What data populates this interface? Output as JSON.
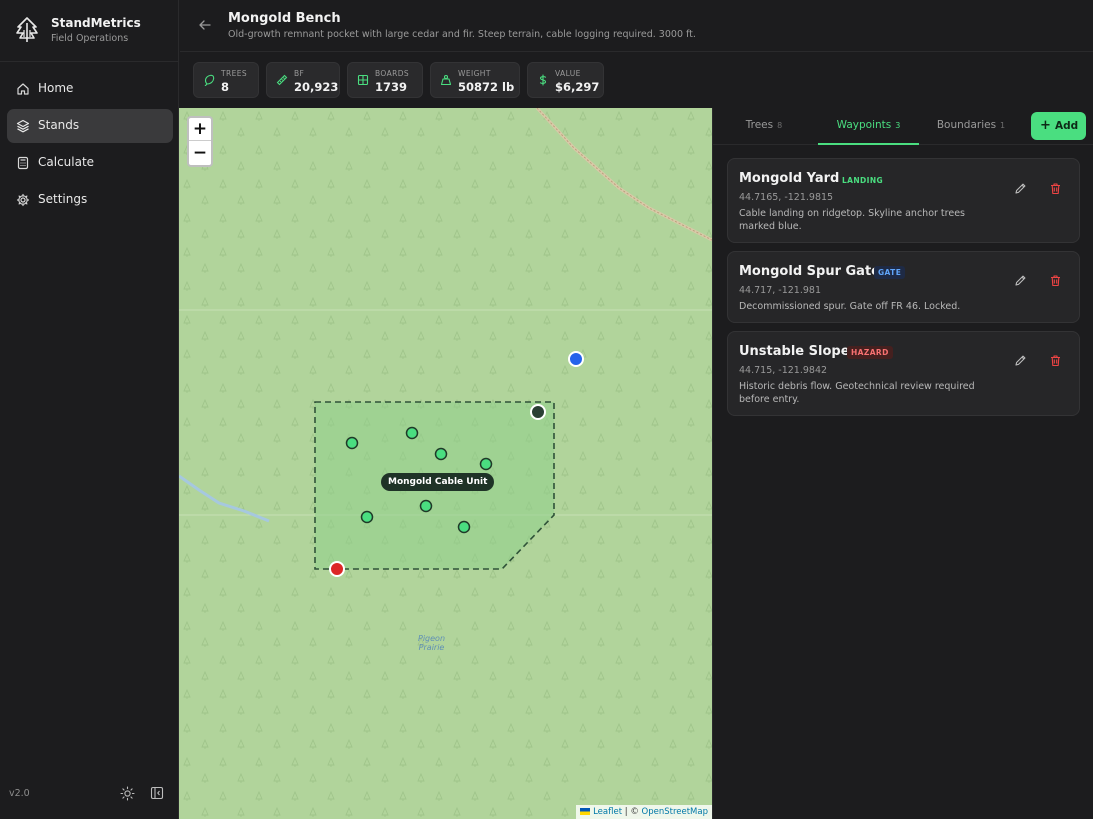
{
  "app": {
    "name": "StandMetrics",
    "subtitle": "Field Operations",
    "version": "v2.0"
  },
  "nav": [
    {
      "label": "Home",
      "icon": "home-icon",
      "active": false
    },
    {
      "label": "Stands",
      "icon": "layers-icon",
      "active": true
    },
    {
      "label": "Calculate",
      "icon": "calculator-icon",
      "active": false
    },
    {
      "label": "Settings",
      "icon": "gear-icon",
      "active": false
    }
  ],
  "header": {
    "title": "Mongold Bench",
    "subtitle": "Old-growth remnant pocket with large cedar and fir. Steep terrain, cable logging required. 3000 ft."
  },
  "stats": [
    {
      "label": "TREES",
      "value": "8",
      "icon": "tree-icon"
    },
    {
      "label": "BF",
      "value": "20,923",
      "icon": "ruler-icon"
    },
    {
      "label": "BOARDS",
      "value": "1739",
      "icon": "grid-icon"
    },
    {
      "label": "WEIGHT",
      "value": "50872 lb",
      "icon": "weight-icon"
    },
    {
      "label": "VALUE",
      "value": "$6,297",
      "icon": "dollar-icon"
    }
  ],
  "map": {
    "zoom_in": "+",
    "zoom_out": "−",
    "polygon_label": "Mongold Cable Unit",
    "place_label_line1": "Pigeon",
    "place_label_line2": "Prairie",
    "attribution_leaflet": "Leaflet",
    "attribution_sep": " | © ",
    "attribution_osm": "OpenStreetMap"
  },
  "tabs": [
    {
      "label": "Trees",
      "count": "8",
      "active": false
    },
    {
      "label": "Waypoints",
      "count": "3",
      "active": true
    },
    {
      "label": "Boundaries",
      "count": "1",
      "active": false
    }
  ],
  "add_button": {
    "label": "Add"
  },
  "waypoints": [
    {
      "name": "Mongold Yard",
      "type": "LANDING",
      "coords": "44.7165, -121.9815",
      "description": "Cable landing on ridgetop. Skyline anchor trees marked blue."
    },
    {
      "name": "Mongold Spur Gate",
      "type": "GATE",
      "coords": "44.717, -121.981",
      "description": "Decommissioned spur. Gate off FR 46. Locked."
    },
    {
      "name": "Unstable Slope",
      "type": "HAZARD",
      "coords": "44.715, -121.9842",
      "description": "Historic debris flow. Geotechnical review required before entry."
    }
  ],
  "colors": {
    "accent": "#4ade80",
    "map_bg": "#b1d49b",
    "marker_tree": "#4ade80",
    "marker_landing": "#2a3f34",
    "marker_gate": "#2563eb",
    "marker_hazard": "#dc2626",
    "danger": "#ef4444"
  }
}
